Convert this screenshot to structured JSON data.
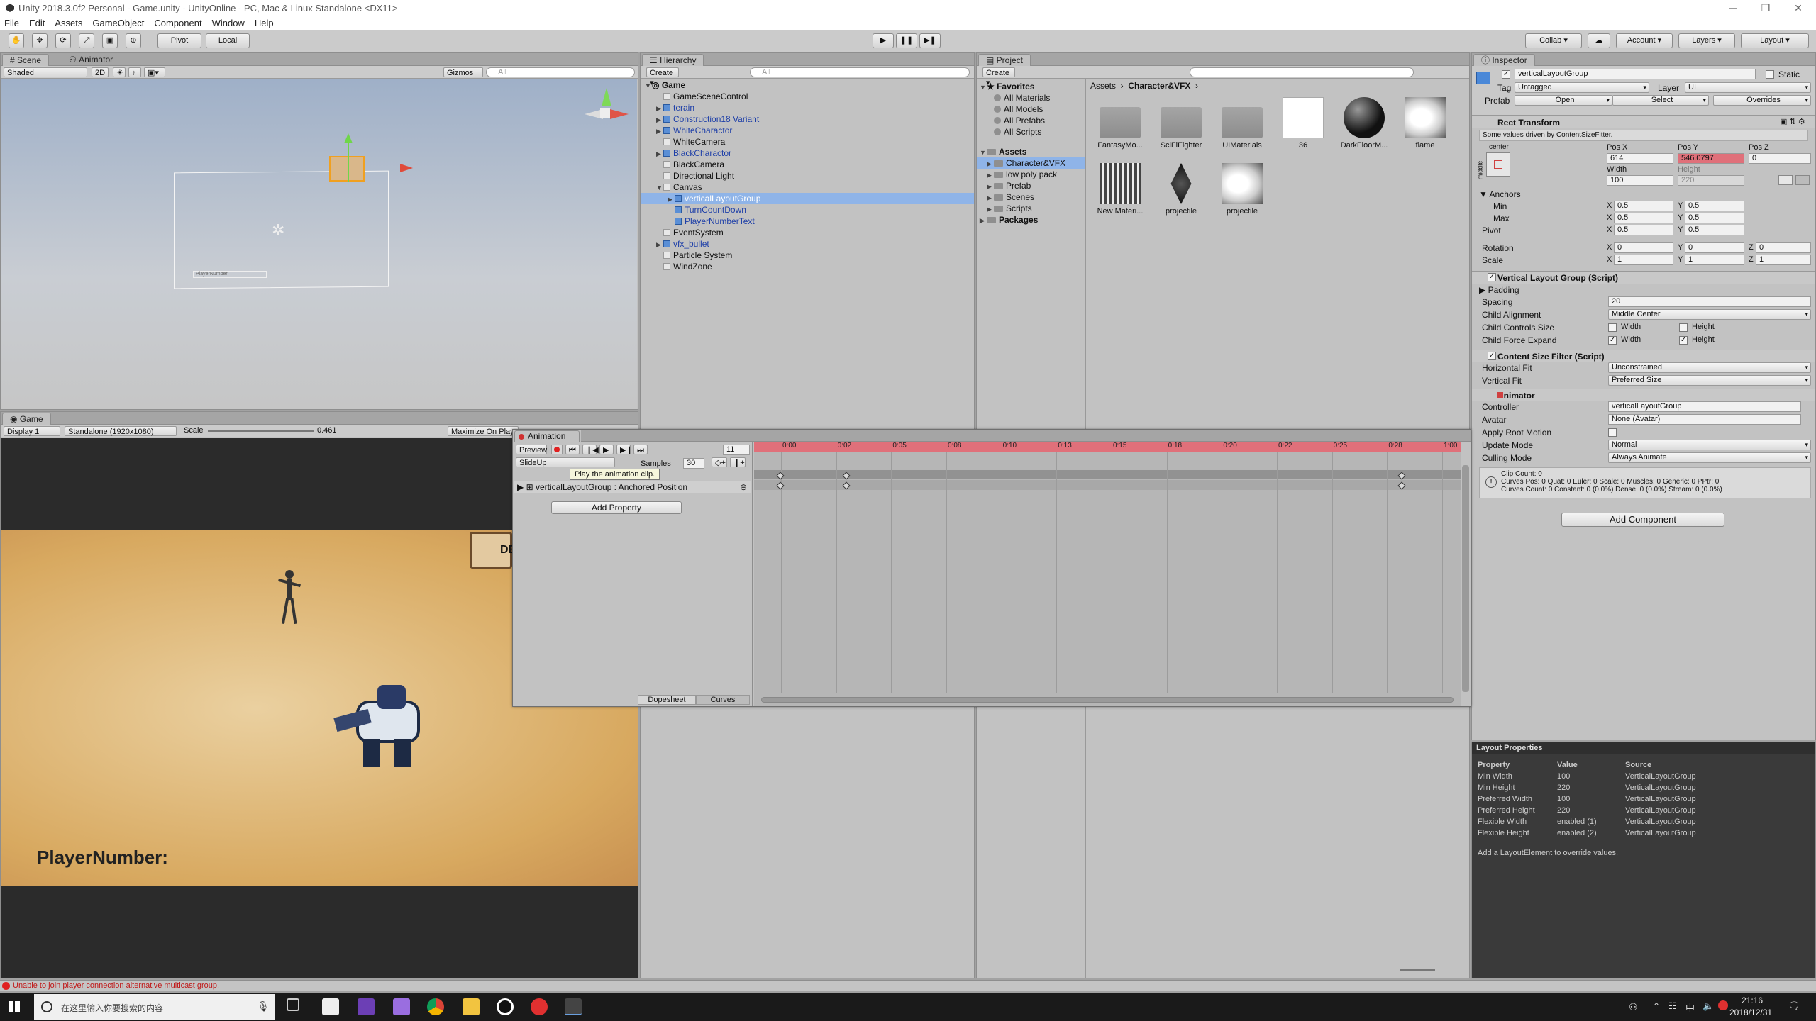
{
  "window": {
    "title": "Unity 2018.3.0f2 Personal - Game.unity - UnityOnline - PC, Mac & Linux Standalone <DX11>"
  },
  "menu": [
    "File",
    "Edit",
    "Assets",
    "GameObject",
    "Component",
    "Window",
    "Help"
  ],
  "toolbar": {
    "pivot": "Pivot",
    "local": "Local",
    "collab": "Collab",
    "account": "Account",
    "layers": "Layers",
    "layout": "Layout"
  },
  "scene": {
    "tabs": [
      "Scene",
      "Animator"
    ],
    "shading": "Shaded",
    "mode2d": "2D",
    "gizmos": "Gizmos",
    "search": "All",
    "ui_label": "PlayerNumber"
  },
  "game": {
    "tab": "Game",
    "display": "Display 1",
    "resolution": "Standalone (1920x1080)",
    "scale_label": "Scale",
    "scale_value": "0.461",
    "maximize": "Maximize On Play",
    "player_text": "PlayerNumber:",
    "button_text": "DE"
  },
  "hierarchy": {
    "tab": "Hierarchy",
    "create": "Create",
    "search": "All",
    "root": "Game",
    "items": [
      {
        "label": "GameSceneControl",
        "indent": 1,
        "blue": false,
        "icon": false,
        "fold": false
      },
      {
        "label": "terain",
        "indent": 1,
        "blue": true,
        "icon": true,
        "fold": true
      },
      {
        "label": "Construction18 Variant",
        "indent": 1,
        "blue": true,
        "icon": true,
        "fold": true
      },
      {
        "label": "WhiteCharactor",
        "indent": 1,
        "blue": true,
        "icon": true,
        "fold": true
      },
      {
        "label": "WhiteCamera",
        "indent": 1,
        "blue": false,
        "icon": false,
        "fold": false
      },
      {
        "label": "BlackCharactor",
        "indent": 1,
        "blue": true,
        "icon": true,
        "fold": true
      },
      {
        "label": "BlackCamera",
        "indent": 1,
        "blue": false,
        "icon": false,
        "fold": false
      },
      {
        "label": "Directional Light",
        "indent": 1,
        "blue": false,
        "icon": false,
        "fold": false
      },
      {
        "label": "Canvas",
        "indent": 1,
        "blue": false,
        "icon": false,
        "fold": true
      },
      {
        "label": "verticalLayoutGroup",
        "indent": 2,
        "blue": true,
        "icon": true,
        "fold": true,
        "selected": true
      },
      {
        "label": "TurnCountDown",
        "indent": 2,
        "blue": true,
        "icon": true,
        "fold": false
      },
      {
        "label": "PlayerNumberText",
        "indent": 2,
        "blue": true,
        "icon": true,
        "fold": false
      },
      {
        "label": "EventSystem",
        "indent": 1,
        "blue": false,
        "icon": false,
        "fold": false
      },
      {
        "label": "vfx_bullet",
        "indent": 1,
        "blue": true,
        "icon": true,
        "fold": true
      },
      {
        "label": "Particle System",
        "indent": 1,
        "blue": false,
        "icon": false,
        "fold": false
      },
      {
        "label": "WindZone",
        "indent": 1,
        "blue": false,
        "icon": false,
        "fold": false
      }
    ]
  },
  "project": {
    "tab": "Project",
    "create": "Create",
    "favorites": "Favorites",
    "fav_items": [
      "All Materials",
      "All Models",
      "All Prefabs",
      "All Scripts"
    ],
    "assets": "Assets",
    "folders": [
      "Character&VFX",
      "low poly pack",
      "Prefab",
      "Scenes",
      "Scripts"
    ],
    "packages": "Packages",
    "breadcrumb": [
      "Assets",
      "Character&VFX"
    ],
    "grid": [
      {
        "label": "FantasyMo...",
        "kind": "folder"
      },
      {
        "label": "SciFiFighter",
        "kind": "folder"
      },
      {
        "label": "UIMaterials",
        "kind": "folder"
      },
      {
        "label": "36",
        "kind": "white"
      },
      {
        "label": "DarkFloorM...",
        "kind": "sphere"
      },
      {
        "label": "flame",
        "kind": "flame"
      },
      {
        "label": "New Materi...",
        "kind": "grid"
      },
      {
        "label": "projectile",
        "kind": "diamond"
      },
      {
        "label": "projectile",
        "kind": "flame2"
      }
    ]
  },
  "animation": {
    "tab": "Animation",
    "preview": "Preview",
    "frame": "11",
    "clip": "SlideUp",
    "samples_label": "Samples",
    "samples": "30",
    "property": "verticalLayoutGroup : Anchored Position",
    "add_property": "Add Property",
    "tooltip": "Play the animation clip.",
    "times": [
      "0:00",
      "0:02",
      "0:05",
      "0:08",
      "0:10",
      "0:13",
      "0:15",
      "0:18",
      "0:20",
      "0:22",
      "0:25",
      "0:28",
      "1:00"
    ],
    "keyframe_fracs": [
      0.0,
      0.1,
      0.94
    ],
    "playhead_frac": 0.37,
    "dopesheet": "Dopesheet",
    "curves": "Curves"
  },
  "inspector": {
    "tab": "Inspector",
    "name": "verticalLayoutGroup",
    "static": "Static",
    "tag_label": "Tag",
    "tag": "Untagged",
    "layer_label": "Layer",
    "layer": "UI",
    "prefab_label": "Prefab",
    "prefab_buttons": [
      "Open",
      "Select",
      "Overrides"
    ],
    "rect": {
      "title": "Rect Transform",
      "note": "Some values driven by ContentSizeFitter.",
      "anchor_preset": "center",
      "side": "middle",
      "col_labels": [
        "Pos X",
        "Pos Y",
        "Pos Z"
      ],
      "pos": [
        "614",
        "546.0797",
        "0"
      ],
      "size_labels": [
        "Width",
        "Height"
      ],
      "size": [
        "100",
        "220"
      ],
      "anchors": "Anchors",
      "min": "Min",
      "max": "Max",
      "pivot": "Pivot",
      "min_vals": [
        "0.5",
        "0.5"
      ],
      "max_vals": [
        "0.5",
        "0.5"
      ],
      "pivot_vals": [
        "0.5",
        "0.5"
      ],
      "rotation": "Rotation",
      "rot_vals": [
        "0",
        "0",
        "0"
      ],
      "scale": "Scale",
      "scale_vals": [
        "1",
        "1",
        "1"
      ],
      "x": "X",
      "y": "Y",
      "z": "Z"
    },
    "vlg": {
      "title": "Vertical Layout Group (Script)",
      "padding": "Padding",
      "spacing_label": "Spacing",
      "spacing": "20",
      "alignment_label": "Child Alignment",
      "alignment": "Middle Center",
      "controls_label": "Child Controls Size",
      "expand_label": "Child Force Expand",
      "width": "Width",
      "height": "Height",
      "check": "✓"
    },
    "csf": {
      "title": "Content Size Filter (Script)",
      "h_label": "Horizontal Fit",
      "h": "Unconstrained",
      "v_label": "Vertical Fit",
      "v": "Preferred Size"
    },
    "animator": {
      "title": "Animator",
      "controller_label": "Controller",
      "controller": "verticalLayoutGroup",
      "avatar_label": "Avatar",
      "avatar": "None (Avatar)",
      "root_label": "Apply Root Motion",
      "update_label": "Update Mode",
      "update": "Normal",
      "culling_label": "Culling Mode",
      "culling": "Always Animate",
      "info1": "Clip Count: 0",
      "info2": "Curves Pos: 0 Quat: 0 Euler: 0 Scale: 0 Muscles: 0 Generic: 0 PPtr: 0",
      "info3": "Curves Count: 0 Constant: 0 (0.0%) Dense: 0 (0.0%) Stream: 0 (0.0%)"
    },
    "add_component": "Add Component"
  },
  "layout_props": {
    "title": "Layout Properties",
    "headers": [
      "Property",
      "Value",
      "Source"
    ],
    "rows": [
      [
        "Min Width",
        "100",
        "VerticalLayoutGroup"
      ],
      [
        "Min Height",
        "220",
        "VerticalLayoutGroup"
      ],
      [
        "Preferred Width",
        "100",
        "VerticalLayoutGroup"
      ],
      [
        "Preferred Height",
        "220",
        "VerticalLayoutGroup"
      ],
      [
        "Flexible Width",
        "enabled (1)",
        "VerticalLayoutGroup"
      ],
      [
        "Flexible Height",
        "enabled (2)",
        "VerticalLayoutGroup"
      ]
    ],
    "note": "Add a LayoutElement to override values."
  },
  "status": {
    "message": "Unable to join player connection alternative multicast group."
  },
  "taskbar": {
    "search": "在这里输入你要搜索的内容",
    "ime": "中",
    "time": "21:16",
    "date": "2018/12/31"
  },
  "colors": {
    "selection": "#3d7bd6",
    "record": "#e0707a",
    "error": "#e02020",
    "panel": "#c2c2c2"
  }
}
